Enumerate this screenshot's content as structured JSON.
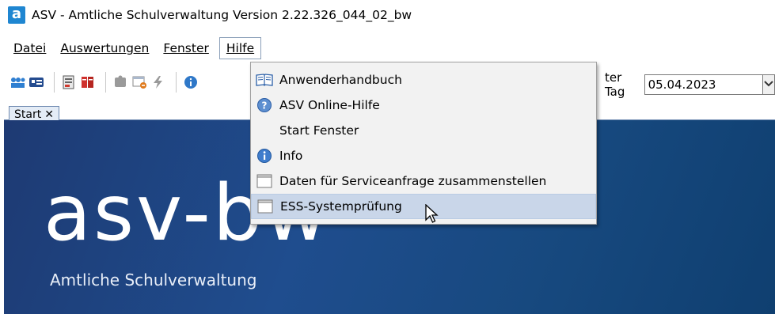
{
  "window": {
    "title": "ASV - Amtliche Schulverwaltung Version 2.22.326_044_02_bw",
    "logo_letter": "a"
  },
  "menubar": {
    "items": [
      {
        "label": "Datei"
      },
      {
        "label": "Auswertungen"
      },
      {
        "label": "Fenster"
      },
      {
        "label": "Hilfe"
      }
    ]
  },
  "toolbar": {
    "stichtag_label": "ter Tag",
    "date_value": "05.04.2023"
  },
  "tabs": [
    {
      "label": "Start",
      "close": "✕"
    }
  ],
  "banner": {
    "logo_text": "asv-bw",
    "subtitle": "Amtliche Schulverwaltung"
  },
  "help_menu": {
    "items": [
      {
        "label": "Anwenderhandbuch",
        "icon": "book-icon"
      },
      {
        "label": "ASV Online-Hilfe",
        "icon": "help-icon"
      },
      {
        "label": "Start Fenster",
        "icon": ""
      },
      {
        "label": "Info",
        "icon": "info-icon"
      },
      {
        "label": "Daten für Serviceanfrage zusammenstellen",
        "icon": "window-icon"
      },
      {
        "label": "ESS-Systemprüfung",
        "icon": "window-icon"
      }
    ]
  },
  "colors": {
    "accent": "#1f86d1",
    "banner": "#1f4d8e",
    "menu_hover": "#c9d6e9"
  }
}
